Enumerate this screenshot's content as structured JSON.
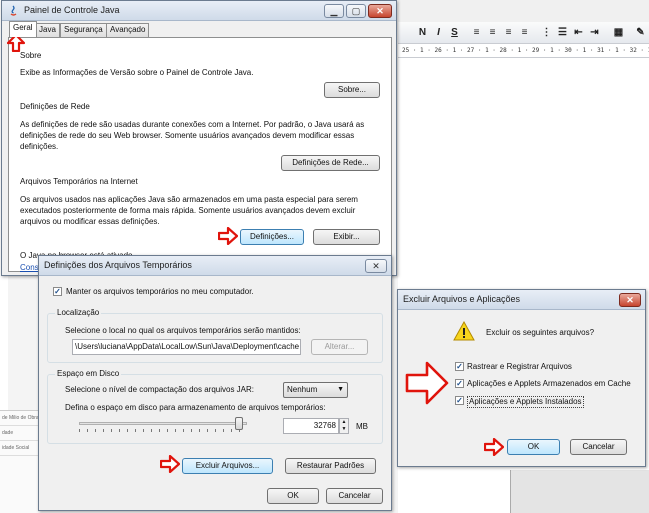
{
  "background": {
    "ruler_text": "25 · 1 · 26 · 1 · 27 · 1 · 28 · 1 · 29 · 1 · 30 · 1 · 31 · 1 · 32 · 1 · 33 · 1",
    "left_strip_items": [
      "de Milio de Obra",
      "dade",
      "idade Social"
    ]
  },
  "java_panel": {
    "title": "Painel de Controle Java",
    "tabs": [
      "Geral",
      "Java",
      "Segurança",
      "Avançado"
    ],
    "about_heading": "Sobre",
    "about_text": "Exibe as Informações de Versão sobre o Painel de Controle Java.",
    "about_button": "Sobre...",
    "network_heading": "Definições de Rede",
    "network_text_1": "As definições de rede são usadas durante conexões com a Internet. Por padrão, o Java usará as",
    "network_text_2": "definições de rede do seu Web browser. Somente usuários avançados devem modificar essas",
    "network_text_3": "definições.",
    "network_button": "Definições de Rede...",
    "temp_heading": "Arquivos Temporários na Internet",
    "temp_text_1": "Os arquivos usados nas aplicações Java são armazenados em uma pasta especial para serem",
    "temp_text_2": "executados posteriormente de forma mais rápida. Somente usuários avançados devem excluir",
    "temp_text_3": "arquivos ou modificar essas definições.",
    "settings_button": "Definições...",
    "view_button": "Exibir...",
    "browser_text": "O Java no browser está ativado.",
    "browser_link": "Consu"
  },
  "temp_dialog": {
    "title": "Definições dos Arquivos Temporários",
    "keep_files": "Manter os arquivos temporários no meu computador.",
    "location_heading": "Localização",
    "location_text": "Selecione o local no qual os arquivos temporários serão mantidos:",
    "location_path": "\\Users\\luciana\\AppData\\LocalLow\\Sun\\Java\\Deployment\\cache",
    "change_button": "Alterar...",
    "disk_heading": "Espaço em Disco",
    "compression_label": "Selecione o nível de compactação dos arquivos JAR:",
    "compression_value": "Nenhum",
    "space_label": "Defina o espaço em disco para armazenamento de arquivos temporários:",
    "space_value": "32768",
    "space_unit": "MB",
    "space_slider_level": 0.95,
    "delete_button": "Excluir Arquivos...",
    "restore_button": "Restaurar Padrões",
    "ok_button": "OK",
    "cancel_button": "Cancelar"
  },
  "delete_dialog": {
    "title": "Excluir Arquivos e Aplicações",
    "question": "Excluir os seguintes arquivos?",
    "options": [
      "Rastrear e Registrar Arquivos",
      "Aplicações e Applets Armazenados em Cache",
      "Aplicações e Applets Instalados"
    ],
    "ok_button": "OK",
    "cancel_button": "Cancelar"
  },
  "colors": {
    "highlight_arrow": "#e0140c",
    "link": "#1a4fb0",
    "title_bar": "#cfdbe9"
  },
  "icons": [
    "java-icon",
    "warning-icon",
    "red-arrow-icon"
  ]
}
